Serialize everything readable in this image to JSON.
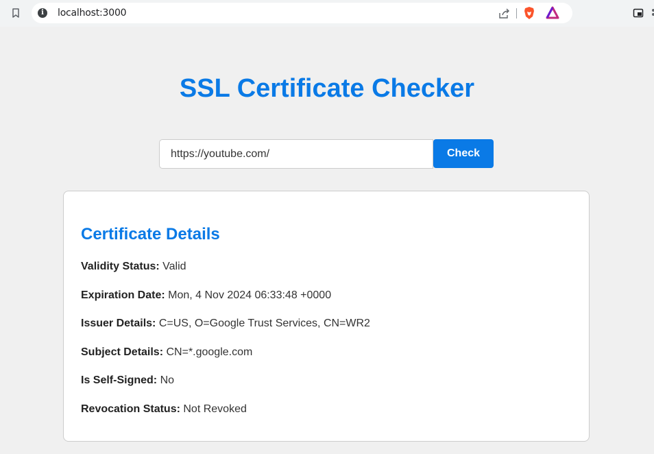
{
  "browser": {
    "url": "localhost:3000",
    "icons": [
      "bookmark-icon",
      "site-info-icon",
      "share-icon",
      "brave-shields-icon",
      "brave-rewards-icon",
      "picture-in-picture-icon"
    ]
  },
  "page": {
    "title": "SSL Certificate Checker"
  },
  "form": {
    "url_value": "https://youtube.com/",
    "check_label": "Check"
  },
  "certificate": {
    "heading": "Certificate Details",
    "details": [
      {
        "label": "Validity Status:",
        "value": "Valid"
      },
      {
        "label": "Expiration Date:",
        "value": "Mon, 4 Nov 2024 06:33:48 +0000"
      },
      {
        "label": "Issuer Details:",
        "value": "C=US, O=Google Trust Services, CN=WR2"
      },
      {
        "label": "Subject Details:",
        "value": "CN=*.google.com"
      },
      {
        "label": "Is Self-Signed:",
        "value": "No"
      },
      {
        "label": "Revocation Status:",
        "value": "Not Revoked"
      }
    ]
  },
  "colors": {
    "accent": "#0a7ae6",
    "background": "#f0f0f0",
    "card": "#ffffff"
  }
}
